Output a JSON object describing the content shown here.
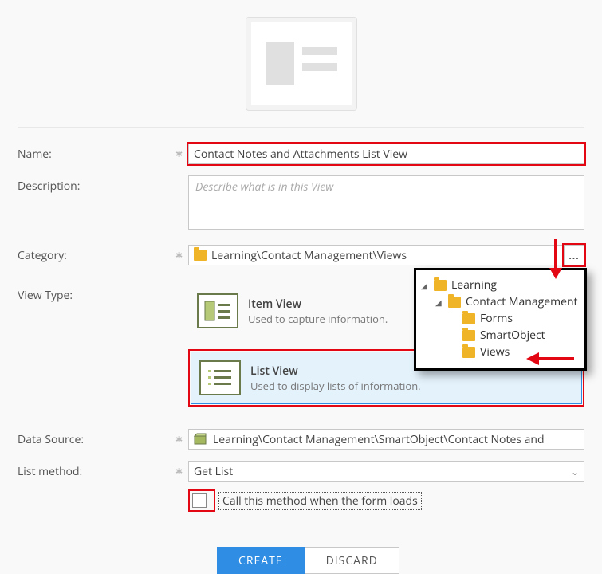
{
  "labels": {
    "name": "Name:",
    "description": "Description:",
    "category": "Category:",
    "view_type": "View Type:",
    "data_source": "Data Source:",
    "list_method": "List method:"
  },
  "fields": {
    "name_value": "Contact Notes and Attachments List View",
    "description_placeholder": "Describe what is in this View",
    "category_value": "Learning\\Contact Management\\Views",
    "data_source_value": "Learning\\Contact Management\\SmartObject\\Contact Notes and",
    "list_method_value": "Get List",
    "checkbox_label": "Call this method when the form loads"
  },
  "view_types": {
    "item": {
      "title": "Item View",
      "desc": "Used to capture information."
    },
    "list": {
      "title": "List View",
      "desc": "Used to display lists of information."
    }
  },
  "buttons": {
    "create": "CREATE",
    "discard": "DISCARD",
    "ellipsis": "..."
  },
  "tree": {
    "root": "Learning",
    "level2": "Contact Management",
    "children": [
      "Forms",
      "SmartObject",
      "Views"
    ]
  },
  "icons": {
    "star": "✱"
  }
}
